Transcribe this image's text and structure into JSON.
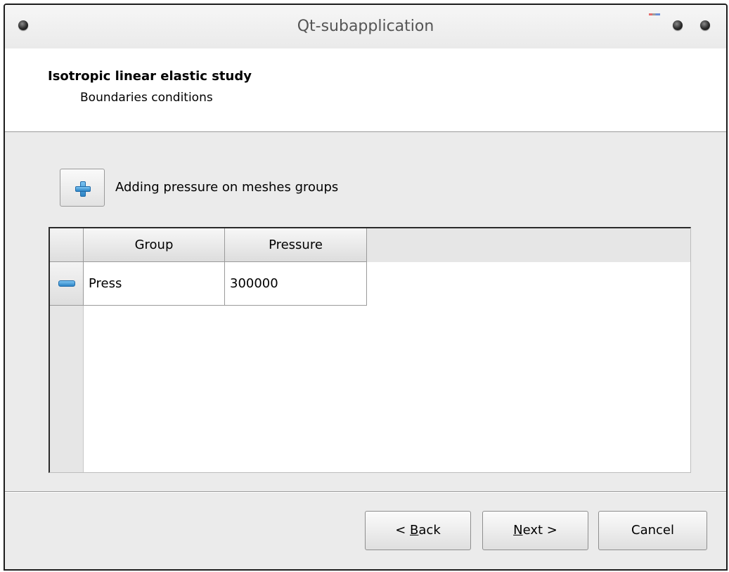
{
  "window": {
    "title": "Qt-subapplication"
  },
  "header": {
    "title": "Isotropic linear elastic study",
    "subtitle": "Boundaries conditions"
  },
  "toolbar": {
    "add_label": "Adding pressure on meshes groups",
    "add_icon": "plus-icon"
  },
  "table": {
    "columns": [
      "Group",
      "Pressure"
    ],
    "rows": [
      {
        "group": "Press",
        "pressure": "300000",
        "remove_icon": "minus-icon"
      }
    ]
  },
  "buttons": {
    "back": {
      "prefix": "< ",
      "mnemonic": "B",
      "rest": "ack"
    },
    "next": {
      "mnemonic": "N",
      "rest": "ext >"
    },
    "cancel": "Cancel"
  },
  "colors": {
    "icon_accent": "#2c84c5",
    "frame_border": "#1c1c1c",
    "background": "#ebebeb"
  }
}
